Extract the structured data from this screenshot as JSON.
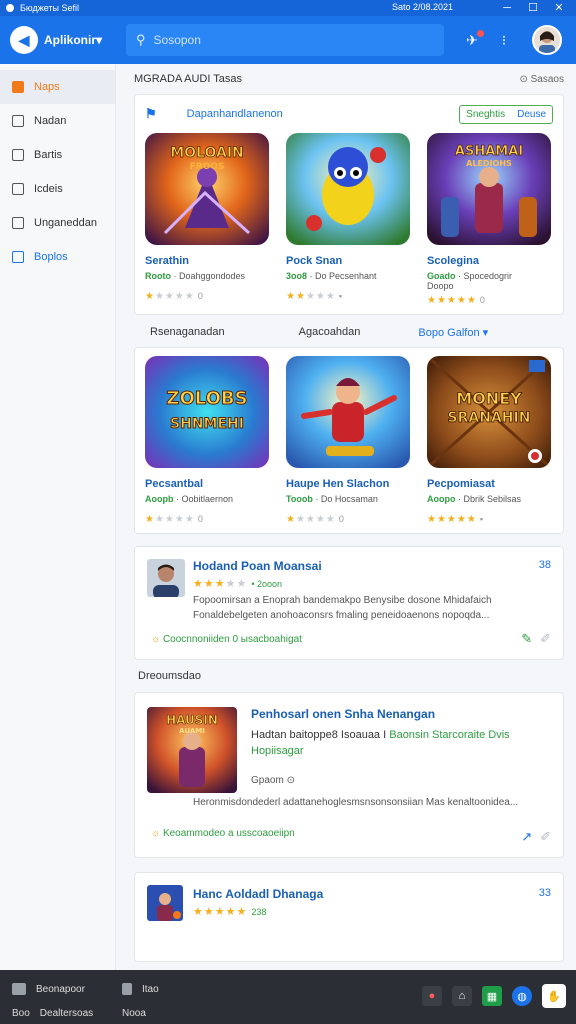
{
  "window": {
    "title": "Бюджеты Sefil",
    "center": "Sato 2/08.2021",
    "controls": [
      "minimize-icon",
      "maximize-icon",
      "close-icon"
    ]
  },
  "header": {
    "brand": "Aplikonir▾",
    "search_placeholder": "Sosopon",
    "icons": [
      "pin-icon",
      "more-icon"
    ]
  },
  "sidebar": {
    "items": [
      {
        "label": "Naps",
        "icon": "home-icon",
        "state": "active"
      },
      {
        "label": "Nadan",
        "icon": "list-icon",
        "state": "normal"
      },
      {
        "label": "Bartis",
        "icon": "bookmark-icon",
        "state": "normal"
      },
      {
        "label": "Icdeis",
        "icon": "gamepad-icon",
        "state": "normal"
      },
      {
        "label": "Unganeddan",
        "icon": "folder-icon",
        "state": "normal"
      },
      {
        "label": "Boplos",
        "icon": "tag-icon",
        "state": "link"
      }
    ]
  },
  "main": {
    "section_title": "MGRADA AUDI Tasas",
    "section_more": "⊙ Sasaos",
    "featured": {
      "label": "Dapanhandlanenon",
      "btn_primary": "Sneghtis",
      "btn_secondary": "Deuse",
      "games": [
        {
          "title": "Serathin",
          "rank": "Rooto",
          "sub": "Doahggondodes",
          "rating": 1,
          "extra": "0",
          "img_text": "MOLOAIN",
          "img_sub": "FROOS"
        },
        {
          "title": "Pock Snan",
          "rank": "3oo8",
          "sub": "Do Pecsenhant",
          "rating": 2,
          "extra": "▪",
          "img_text": "",
          "img_sub": ""
        },
        {
          "title": "Scolegina",
          "rank": "Goado",
          "sub": "Spocedogrir",
          "sub2": "Doopo",
          "rating": 5,
          "extra": "0",
          "img_text": "ASHAMAI",
          "img_sub": "ALEDIOHS"
        }
      ]
    },
    "row_labels": [
      "Rsenaganadan",
      "Agacoahdan",
      "Bopo Galfon ▾"
    ],
    "games2": [
      {
        "title": "Pecsantbal",
        "rank": "Aoopb",
        "sub": "Oobitlaernon",
        "rating": 1,
        "extra": "0",
        "img_text": "ZOLOBS",
        "img_sub": "SHNMEHI"
      },
      {
        "title": "Haupe Hen Slachon",
        "rank": "Tooob",
        "sub": "Do Hocsaman",
        "rating": 1,
        "extra": "0",
        "img_text": "",
        "img_sub": ""
      },
      {
        "title": "Pecpomiasat",
        "rank": "Aoopo",
        "sub": "Dbrik Sebilsas",
        "rating": 5,
        "extra": "▪",
        "img_text": "MONEY",
        "img_sub": "SRANAHIN"
      }
    ],
    "review": {
      "title": "Hodand Poan Moansai",
      "count": "38",
      "rating": 3,
      "rating_text": "• 2ooon",
      "text": "Fopoomirsan a Enoprah bandemakpo Benysibe dosone Mhidafaich Fonaldebelgeten anohoaconsrs fmaling peneidoaenons nopoqda...",
      "footer_lead": "☼",
      "footer": "Coocnnoniiden 0 ыsacboahigat"
    },
    "section_label": "Dreoumsdao",
    "feature": {
      "title": "Penhosarl onen Snha Nenangan",
      "desc": "Hadtan baitoppe8 Isoauaa I",
      "desc_green": "Baonsin Starcoraite Dvis Hopiisagar",
      "meta": "Gpaom ⊙",
      "body": "Heronmisdondederl adattanehoglesmsnsonsonsiian Mas kenaltoonidea...",
      "footer_lead": "☼",
      "footer": "Keoammodeo a usscoaoeiipn",
      "img_text": "HAUSIN",
      "img_sub": "AUAMI"
    },
    "mini": {
      "title": "Hanc Aoldadl Dhanaga",
      "count": "33",
      "rating": 5,
      "rating_text": "238"
    }
  },
  "taskbar": {
    "left_top": "Beonapoor",
    "left_bottom_a": "Boo",
    "left_bottom_b": "Dealtersoas",
    "mid_top": "Itao",
    "mid_bottom": "Nooa",
    "tray": [
      "record-icon",
      "home-icon",
      "sheet-icon",
      "globe-icon",
      "hand-icon"
    ]
  },
  "colors": {
    "accent": "#1a73e8",
    "active": "#f07a1a",
    "green": "#2e9d3f",
    "star": "#f2b01e"
  }
}
